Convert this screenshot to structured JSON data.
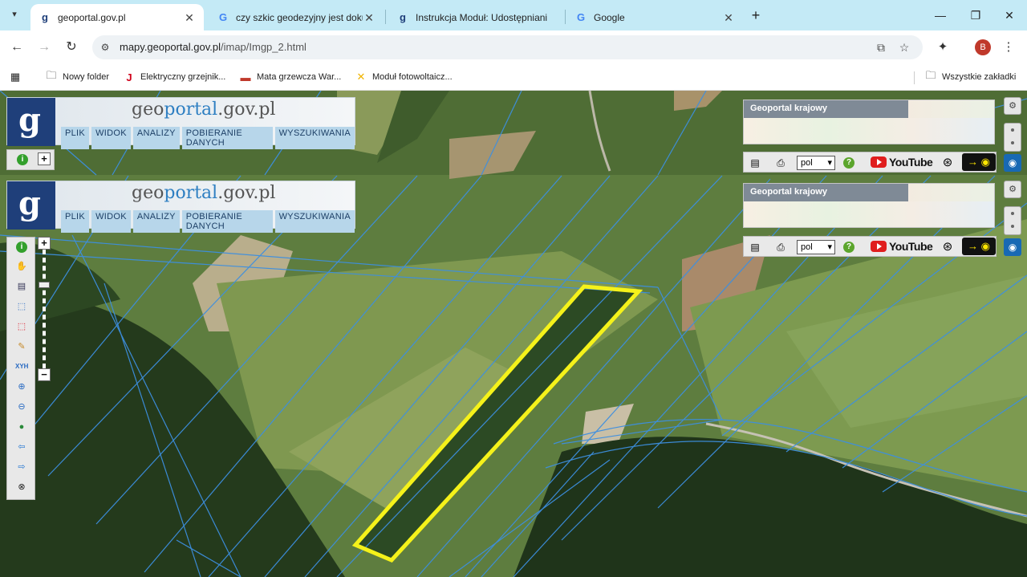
{
  "browser": {
    "tabs": [
      {
        "title": "geoportal.gov.pl",
        "favicon": "geoportal-favicon",
        "active": true
      },
      {
        "title": "czy szkic geodezyjny jest dokum",
        "favicon": "google-favicon",
        "active": false
      },
      {
        "title": "Instrukcja Moduł: Udostępniani",
        "favicon": "geoportal-favicon",
        "active": false
      },
      {
        "title": "Google",
        "favicon": "google-favicon",
        "active": false
      }
    ],
    "url_host": "mapy.geoportal.gov.pl",
    "url_path": "/imap/Imgp_2.html",
    "avatar_letter": "B",
    "bookmarks": [
      {
        "label": "Nowy folder",
        "icon": "folder-icon"
      },
      {
        "label": "Elektryczny grzejnik...",
        "icon": "j-logo-icon"
      },
      {
        "label": "Mata grzewcza War...",
        "icon": "heat-mat-icon"
      },
      {
        "label": "Moduł fotowoltaicz...",
        "icon": "solar-icon"
      }
    ],
    "all_bookmarks_label": "Wszystkie zakładki"
  },
  "geoportal": {
    "title_g": "g",
    "title_eo": "eo",
    "title_portal": "portal",
    "title_rest": ".gov.pl",
    "menu": [
      "PLIK",
      "WIDOK",
      "ANALIZY",
      "POBIERANIE DANYCH",
      "WYSZUKIWANIA"
    ],
    "national_panel_title": "Geoportal krajowy",
    "language": "pol",
    "youtube_label": "YouTube",
    "colors": {
      "parcel_lines": "#3d8fe0",
      "highlight": "#f5f21a",
      "logo_bg": "#1f3f7a"
    }
  }
}
